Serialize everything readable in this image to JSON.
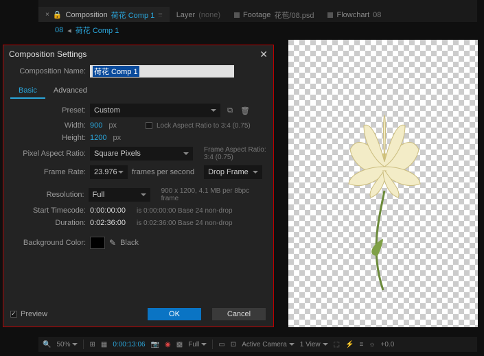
{
  "workspace": {
    "tabs": [
      {
        "close": "×",
        "prefix": "Composition",
        "name": "荷花 Comp 1",
        "tail": "≡"
      },
      {
        "prefix": "Layer",
        "name": "(none)"
      },
      {
        "prefix": "Footage",
        "name": "花苞/08.psd"
      },
      {
        "prefix": "Flowchart",
        "name": "08"
      }
    ],
    "crumbs": {
      "root": "08",
      "sep": "◂",
      "comp": "荷花 Comp 1"
    }
  },
  "dialog": {
    "title": "Composition Settings",
    "close": "✕",
    "name_label": "Composition Name:",
    "name_value": "荷花 Comp 1",
    "tabs": {
      "basic": "Basic",
      "advanced": "Advanced"
    },
    "preset_label": "Preset:",
    "preset_value": "Custom",
    "save_icon": "⧉",
    "trash_icon": "🗑",
    "width_label": "Width:",
    "width_value": "900",
    "height_label": "Height:",
    "height_value": "1200",
    "px": "px",
    "lock_label": "Lock Aspect Ratio to 3:4 (0.75)",
    "par_label": "Pixel Aspect Ratio:",
    "par_value": "Square Pixels",
    "far_label": "Frame Aspect Ratio:",
    "far_value": "3:4 (0.75)",
    "fr_label": "Frame Rate:",
    "fr_value": "23.976",
    "fr_unit": "frames per second",
    "fr_drop": "Drop Frame",
    "res_label": "Resolution:",
    "res_value": "Full",
    "res_info": "900 x 1200, 4.1 MB per 8bpc frame",
    "stc_label": "Start Timecode:",
    "stc_value": "0:00:00:00",
    "stc_info": "is 0:00:00:00  Base 24  non-drop",
    "dur_label": "Duration:",
    "dur_value": "0:02:36:00",
    "dur_info": "is 0:02:36:00  Base 24  non-drop",
    "bg_label": "Background Color:",
    "bg_name": "Black",
    "preview_label": "Preview",
    "ok": "OK",
    "cancel": "Cancel"
  },
  "bottom": {
    "zoom": "50%",
    "timecode": "0:00:13:06",
    "quality": "Full",
    "camera": "Active Camera",
    "views": "1 View",
    "exposure": "+0.0"
  }
}
